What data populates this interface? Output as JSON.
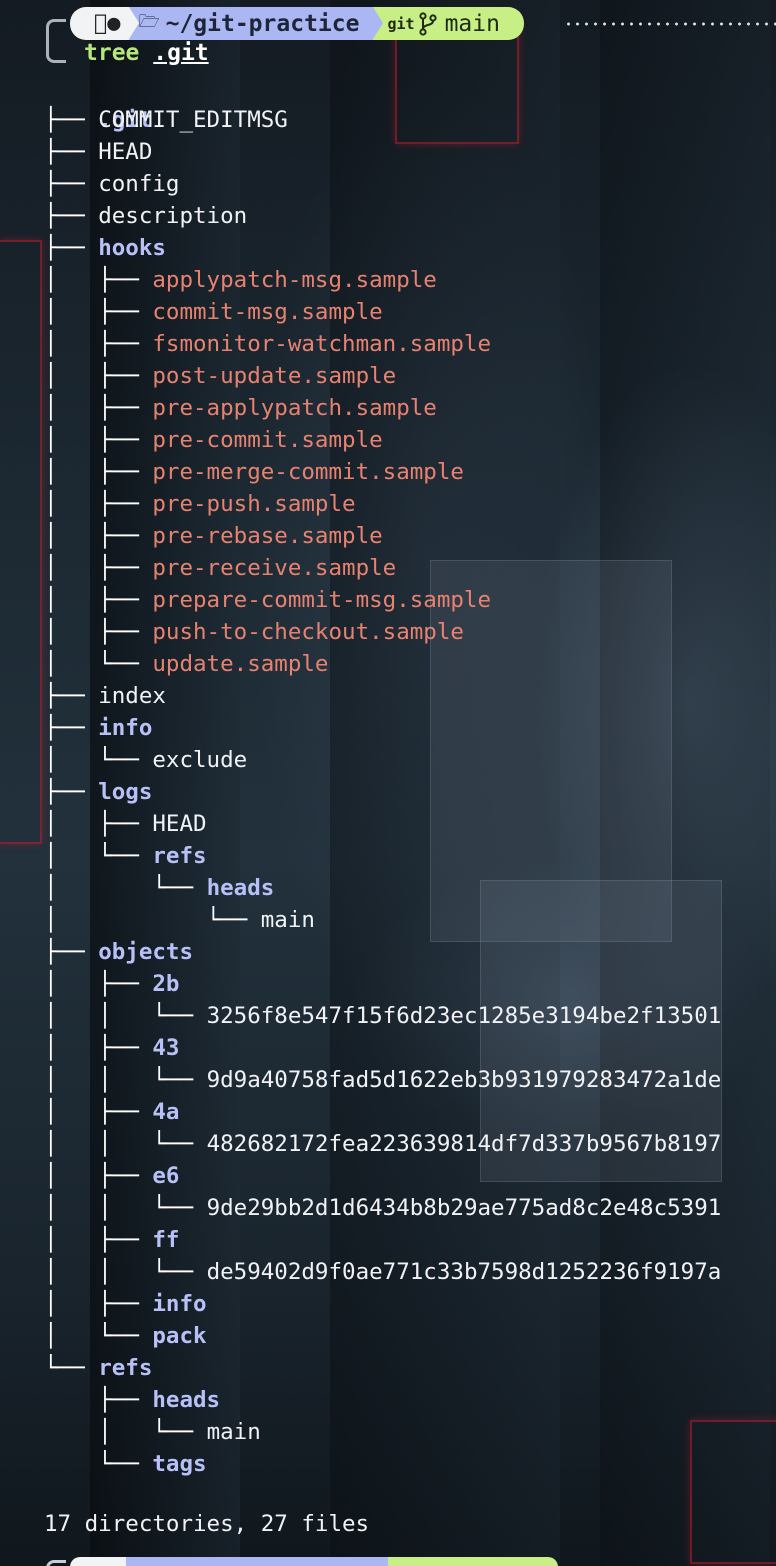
{
  "prompt": {
    "os_icon": "apple-icon",
    "folder_icon": "folder-icon",
    "directory": "~/git-practice",
    "git_label": "git",
    "branch_icon": "git-branch-icon",
    "branch": "main"
  },
  "command": {
    "name": "tree",
    "argument": ".git"
  },
  "tree_root": ".git",
  "tree_rows": [
    {
      "prefix": "├── ",
      "name": "COMMIT_EDITMSG",
      "kind": "file"
    },
    {
      "prefix": "├── ",
      "name": "HEAD",
      "kind": "file"
    },
    {
      "prefix": "├── ",
      "name": "config",
      "kind": "file"
    },
    {
      "prefix": "├── ",
      "name": "description",
      "kind": "file"
    },
    {
      "prefix": "├── ",
      "name": "hooks",
      "kind": "dir"
    },
    {
      "prefix": "│   ├── ",
      "name": "applypatch-msg.sample",
      "kind": "hook"
    },
    {
      "prefix": "│   ├── ",
      "name": "commit-msg.sample",
      "kind": "hook"
    },
    {
      "prefix": "│   ├── ",
      "name": "fsmonitor-watchman.sample",
      "kind": "hook"
    },
    {
      "prefix": "│   ├── ",
      "name": "post-update.sample",
      "kind": "hook"
    },
    {
      "prefix": "│   ├── ",
      "name": "pre-applypatch.sample",
      "kind": "hook"
    },
    {
      "prefix": "│   ├── ",
      "name": "pre-commit.sample",
      "kind": "hook"
    },
    {
      "prefix": "│   ├── ",
      "name": "pre-merge-commit.sample",
      "kind": "hook"
    },
    {
      "prefix": "│   ├── ",
      "name": "pre-push.sample",
      "kind": "hook"
    },
    {
      "prefix": "│   ├── ",
      "name": "pre-rebase.sample",
      "kind": "hook"
    },
    {
      "prefix": "│   ├── ",
      "name": "pre-receive.sample",
      "kind": "hook"
    },
    {
      "prefix": "│   ├── ",
      "name": "prepare-commit-msg.sample",
      "kind": "hook"
    },
    {
      "prefix": "│   ├── ",
      "name": "push-to-checkout.sample",
      "kind": "hook"
    },
    {
      "prefix": "│   └── ",
      "name": "update.sample",
      "kind": "hook"
    },
    {
      "prefix": "├── ",
      "name": "index",
      "kind": "file"
    },
    {
      "prefix": "├── ",
      "name": "info",
      "kind": "dir"
    },
    {
      "prefix": "│   └── ",
      "name": "exclude",
      "kind": "file"
    },
    {
      "prefix": "├── ",
      "name": "logs",
      "kind": "dir"
    },
    {
      "prefix": "│   ├── ",
      "name": "HEAD",
      "kind": "file"
    },
    {
      "prefix": "│   └── ",
      "name": "refs",
      "kind": "dir"
    },
    {
      "prefix": "│       └── ",
      "name": "heads",
      "kind": "dir"
    },
    {
      "prefix": "│           └── ",
      "name": "main",
      "kind": "file"
    },
    {
      "prefix": "├── ",
      "name": "objects",
      "kind": "dir"
    },
    {
      "prefix": "│   ├── ",
      "name": "2b",
      "kind": "dir"
    },
    {
      "prefix": "│   │   └── ",
      "name": "3256f8e547f15f6d23ec1285e3194be2f13501",
      "kind": "file"
    },
    {
      "prefix": "│   ├── ",
      "name": "43",
      "kind": "dir"
    },
    {
      "prefix": "│   │   └── ",
      "name": "9d9a40758fad5d1622eb3b931979283472a1de",
      "kind": "file"
    },
    {
      "prefix": "│   ├── ",
      "name": "4a",
      "kind": "dir"
    },
    {
      "prefix": "│   │   └── ",
      "name": "482682172fea223639814df7d337b9567b8197",
      "kind": "file"
    },
    {
      "prefix": "│   ├── ",
      "name": "e6",
      "kind": "dir"
    },
    {
      "prefix": "│   │   └── ",
      "name": "9de29bb2d1d6434b8b29ae775ad8c2e48c5391",
      "kind": "file"
    },
    {
      "prefix": "│   ├── ",
      "name": "ff",
      "kind": "dir"
    },
    {
      "prefix": "│   │   └── ",
      "name": "de59402d9f0ae771c33b7598d1252236f9197a",
      "kind": "file"
    },
    {
      "prefix": "│   ├── ",
      "name": "info",
      "kind": "dir"
    },
    {
      "prefix": "│   └── ",
      "name": "pack",
      "kind": "dir"
    },
    {
      "prefix": "└── ",
      "name": "refs",
      "kind": "dir"
    },
    {
      "prefix": "    ├── ",
      "name": "heads",
      "kind": "dir"
    },
    {
      "prefix": "    │   └── ",
      "name": "main",
      "kind": "file"
    },
    {
      "prefix": "    └── ",
      "name": "tags",
      "kind": "dir"
    }
  ],
  "summary": "17 directories, 27 files",
  "colors": {
    "directory": "#b8c1f7",
    "file": "#f1f2f5",
    "hook_sample": "#e88270",
    "command": "#b7e77b",
    "prompt_os_segment": "#f2f3f5",
    "prompt_dir_segment": "#aab7f2",
    "prompt_git_segment": "#c8ef86"
  }
}
